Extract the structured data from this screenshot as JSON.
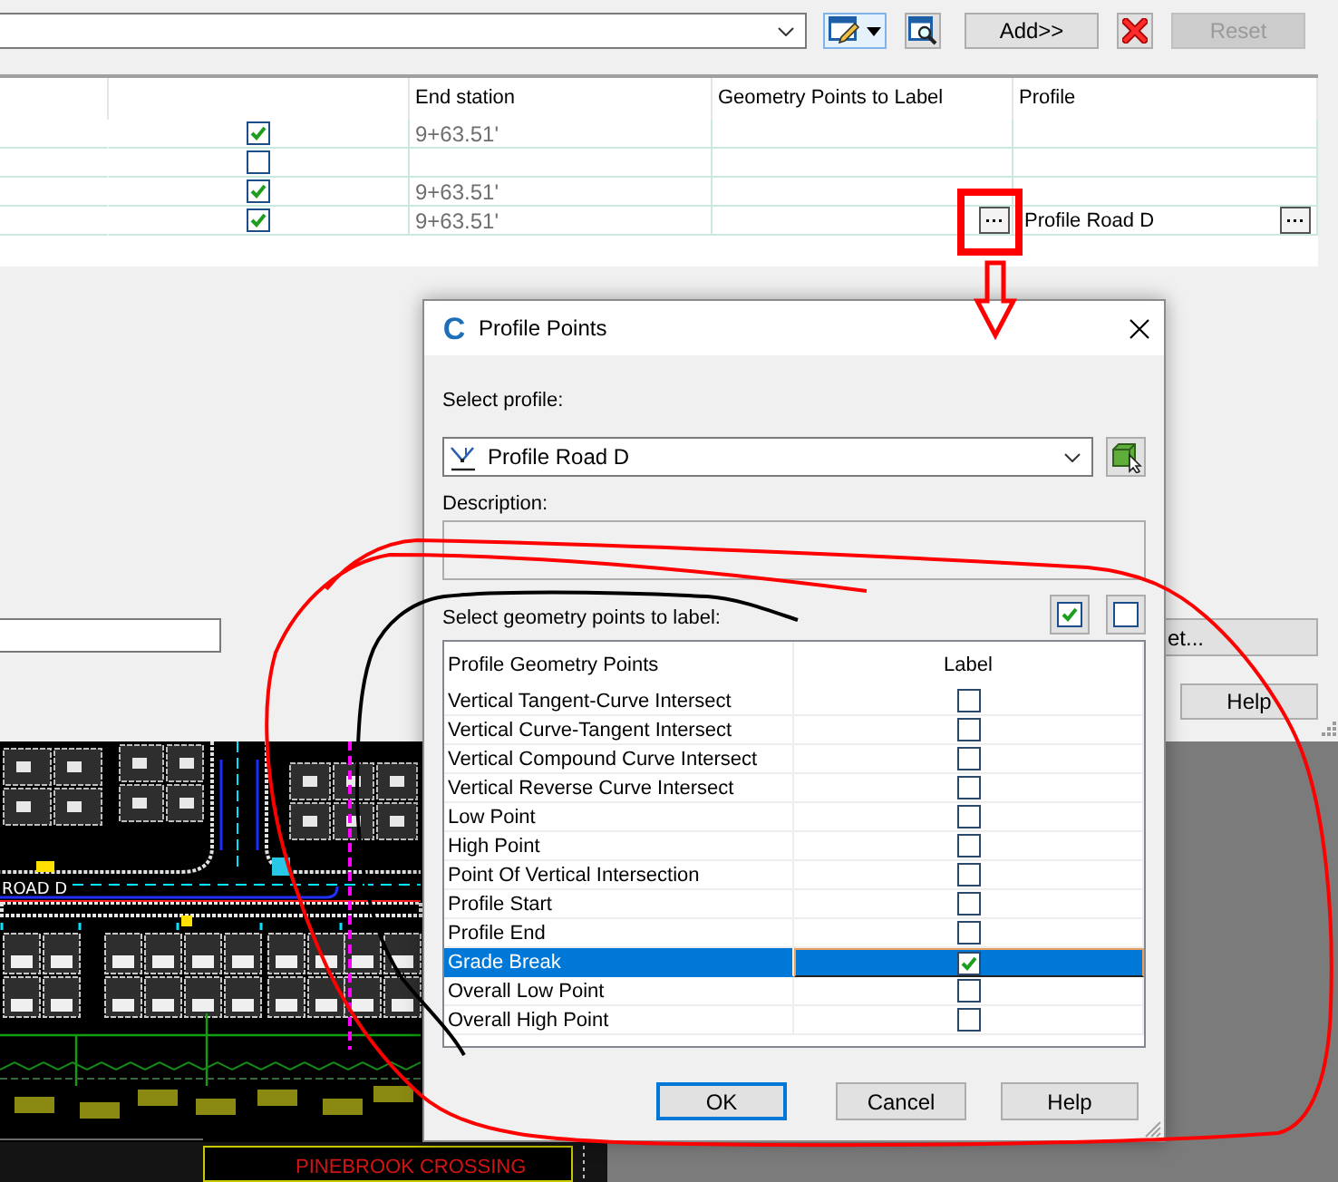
{
  "main_window": {
    "toolbar": {
      "add_button": "Add>>",
      "reset_button": {
        "label": "Reset",
        "disabled": true
      }
    },
    "grid": {
      "columns": [
        {
          "label": "End station"
        },
        {
          "label": "Geometry Points to Label"
        },
        {
          "label": "Profile"
        }
      ],
      "rows": [
        {
          "checked": true,
          "end_station": "9+63.51'",
          "editing": false
        },
        {
          "checked": false,
          "editing": false
        },
        {
          "checked": true,
          "end_station": "9+63.51'",
          "editing": false
        },
        {
          "checked": true,
          "end_station": "9+63.51'",
          "profile": "Profile Road D",
          "editing": true
        }
      ]
    },
    "side_buttons": [
      {
        "label": "et...",
        "kind": "clipped"
      },
      {
        "label": "Help",
        "kind": "plain"
      }
    ]
  },
  "cad_view": {
    "street_label": "ROAD D",
    "title_block": "PINEBROOK CROSSING"
  },
  "dialog": {
    "logo_letter": "C",
    "title": "Profile Points",
    "profile_label": "Select profile:",
    "profile_value": "Profile Road D",
    "description_label": "Description:",
    "points_label": "Select geometry points to label:",
    "list": {
      "columns": [
        "Profile Geometry Points",
        "Label"
      ],
      "rows": [
        {
          "name": "Vertical Tangent-Curve Intersect",
          "checked": false,
          "selected": false
        },
        {
          "name": "Vertical Curve-Tangent Intersect",
          "checked": false,
          "selected": false
        },
        {
          "name": "Vertical Compound Curve Intersect",
          "checked": false,
          "selected": false
        },
        {
          "name": "Vertical Reverse Curve Intersect",
          "checked": false,
          "selected": false
        },
        {
          "name": "Low Point",
          "checked": false,
          "selected": false
        },
        {
          "name": "High Point",
          "checked": false,
          "selected": false
        },
        {
          "name": "Point Of Vertical Intersection",
          "checked": false,
          "selected": false
        },
        {
          "name": "Profile Start",
          "checked": false,
          "selected": false
        },
        {
          "name": "Profile End",
          "checked": false,
          "selected": false
        },
        {
          "name": "Grade Break",
          "checked": true,
          "selected": true
        },
        {
          "name": "Overall Low Point",
          "checked": false,
          "selected": false
        },
        {
          "name": "Overall High Point",
          "checked": false,
          "selected": false
        }
      ]
    },
    "buttons": [
      {
        "label": "OK",
        "default": true
      },
      {
        "label": "Cancel",
        "default": false
      },
      {
        "label": "Help",
        "default": false
      }
    ]
  }
}
